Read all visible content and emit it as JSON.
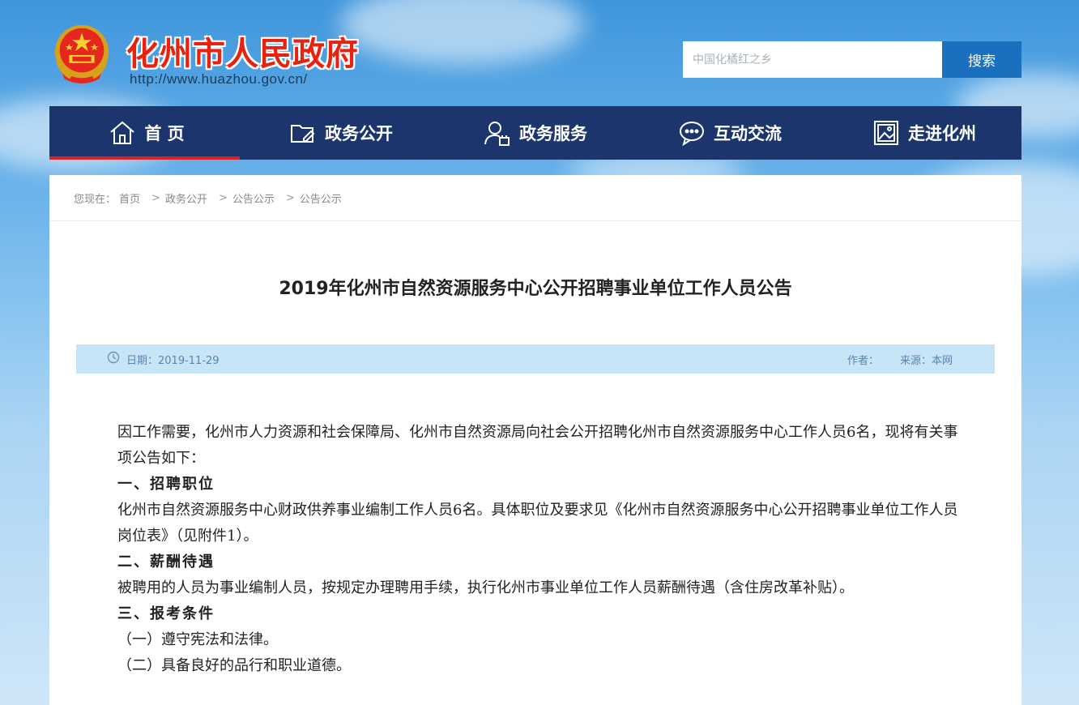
{
  "header": {
    "site_title": "化州市人民政府",
    "site_url": "http://www.huazhou.gov.cn/",
    "search_placeholder": "中国化橘红之乡",
    "search_button": "搜索"
  },
  "nav": {
    "items": [
      {
        "label": "首 页",
        "icon": "home-icon"
      },
      {
        "label": "政务公开",
        "icon": "folder-edit-icon"
      },
      {
        "label": "政务服务",
        "icon": "user-service-icon"
      },
      {
        "label": "互动交流",
        "icon": "chat-icon"
      },
      {
        "label": "走进化州",
        "icon": "picture-icon"
      }
    ],
    "active_index": 0
  },
  "breadcrumb": {
    "prefix": "您现在：",
    "items": [
      "首页",
      "政务公开",
      "公告公示",
      "公告公示"
    ],
    "separator": ">"
  },
  "article": {
    "title": "2019年化州市自然资源服务中心公开招聘事业单位工作人员公告",
    "date_label": "日期：2019-11-29",
    "author_label": "作者：",
    "source_label": "来源：本网",
    "paragraphs": [
      {
        "text": "因工作需要，化州市人力资源和社会保障局、化州市自然资源局向社会公开招聘化州市自然资源服务中心工作人员6名，现将有关事项公告如下：",
        "style": "indent"
      },
      {
        "text": "一、招聘职位",
        "style": "heading"
      },
      {
        "text": "化州市自然资源服务中心财政供养事业编制工作人员6名。具体职位及要求见《化州市自然资源服务中心公开招聘事业单位工作人员岗位表》（见附件1）。",
        "style": "normal"
      },
      {
        "text": "二、薪酬待遇",
        "style": "heading"
      },
      {
        "text": "被聘用的人员为事业编制人员，按规定办理聘用手续，执行化州市事业单位工作人员薪酬待遇（含住房改革补贴）。",
        "style": "normal"
      },
      {
        "text": "三、报考条件",
        "style": "heading"
      },
      {
        "text": "（一）遵守宪法和法律。",
        "style": "normal"
      },
      {
        "text": "（二）具备良好的品行和职业道德。",
        "style": "normal"
      }
    ]
  },
  "colors": {
    "nav_bg": "#1c356c",
    "nav_active_underline": "#e02020",
    "search_button": "#1b6fbf",
    "meta_bar": "#c8e4f7",
    "title_red": "#e8220f"
  }
}
